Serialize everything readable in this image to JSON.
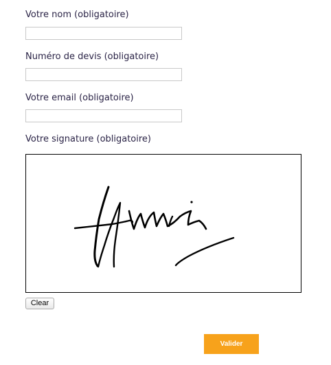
{
  "form": {
    "name_field": {
      "label": "Votre nom (obligatoire)",
      "value": "",
      "placeholder": ""
    },
    "quote_field": {
      "label": "Numéro de devis (obligatoire)",
      "value": "",
      "placeholder": ""
    },
    "email_field": {
      "label": "Votre email (obligatoire)",
      "value": "",
      "placeholder": ""
    },
    "signature": {
      "label": "Votre signature (obligatoire)",
      "ink_color": "#000000",
      "border_color": "#000000"
    },
    "clear_label": "Clear",
    "submit_label": "Valider"
  },
  "colors": {
    "label_text": "#2a2346",
    "input_border": "#c8c8c8",
    "submit_background": "#f7a21b",
    "submit_text": "#ffffff"
  }
}
